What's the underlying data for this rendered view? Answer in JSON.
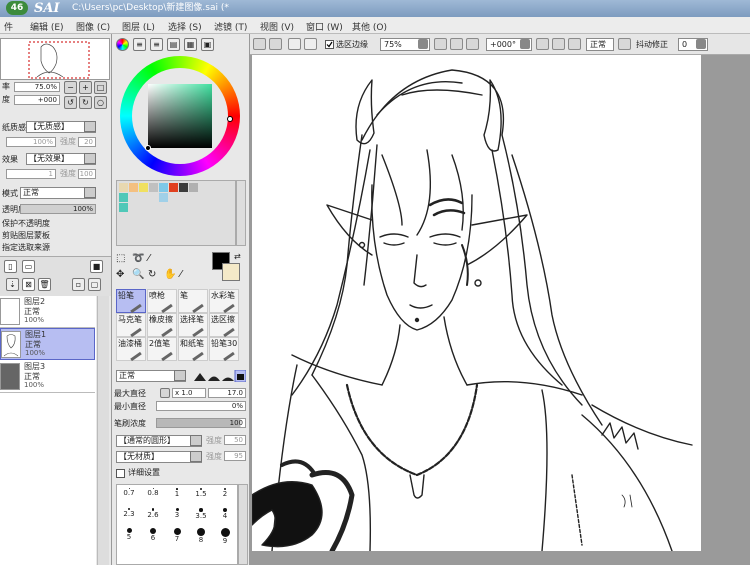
{
  "window": {
    "badge": "46",
    "app_logo": "SAI",
    "title": "C:\\Users\\pc\\Desktop\\新建图像.sai (*"
  },
  "menu": [
    "编辑 (E)",
    "图像 (C)",
    "图层 (L)",
    "选择 (S)",
    "滤镜 (T)",
    "视图 (V)",
    "窗口 (W)",
    "其他 (O)"
  ],
  "toolbar": {
    "select_edge_label": "选区边缘",
    "zoom": "75%",
    "rotation": "+000°",
    "mode": "正常",
    "stabilizer_label": "抖动修正",
    "stabilizer_value": "0"
  },
  "navigator": {
    "zoom_value": "75.0%",
    "angle_value": "+000"
  },
  "layer_props": {
    "texture_label": "纸质感",
    "texture_value": "【无质感】",
    "texture_v1": "100%",
    "texture_v2": "20",
    "effect_label": "效果",
    "effect_value": "【无效果】",
    "effect_v1": "1",
    "effect_v2": "100",
    "blend_label": "模式",
    "blend_value": "正常",
    "opacity_label": "透明度",
    "opacity_value": "100%",
    "check1": "保护不透明度",
    "check2": "剪贴图层蒙板",
    "check3": "指定选取来源"
  },
  "layers": [
    {
      "name": "图层2",
      "mode": "正常",
      "opacity": "100%"
    },
    {
      "name": "图层1",
      "mode": "正常",
      "opacity": "100%"
    },
    {
      "name": "图层3",
      "mode": "正常",
      "opacity": "100%"
    }
  ],
  "tools": [
    {
      "name": "铅笔"
    },
    {
      "name": "喷枪"
    },
    {
      "name": "笔"
    },
    {
      "name": "水彩笔"
    },
    {
      "name": "马克笔"
    },
    {
      "name": "橡皮擦"
    },
    {
      "name": "选择笔"
    },
    {
      "name": "选区擦"
    },
    {
      "name": "油漆桶"
    },
    {
      "name": "2值笔"
    },
    {
      "name": "和纸笔"
    },
    {
      "name": "铅笔30"
    }
  ],
  "brush": {
    "blend_mode": "正常",
    "max_size_label": "最大直径",
    "size_multiplier": "x 1.0",
    "size_value": "17.0",
    "min_size_label": "最小直径",
    "min_size_value": "0%",
    "density_label": "笔刷浓度",
    "density_value": "100",
    "shape_value": "【通常的圆形】",
    "shape_strength": "50",
    "texture_value": "【无材质】",
    "texture_strength": "95",
    "detail_label": "详细设置"
  },
  "brush_sizes": [
    "0.7",
    "0.8",
    "1",
    "1.5",
    "2",
    "2.3",
    "2.6",
    "3",
    "3.5",
    "4",
    "5",
    "6",
    "7",
    "8",
    "9"
  ],
  "colors": {
    "primary": "#000000",
    "secondary": "#f4e9c8",
    "palette": [
      "#e8d8b0",
      "#f4c080",
      "#f0e060",
      "#7ec8e8",
      "#e04020",
      "#3c3c3c",
      "#b0b0b0",
      "#50c8b8"
    ]
  }
}
